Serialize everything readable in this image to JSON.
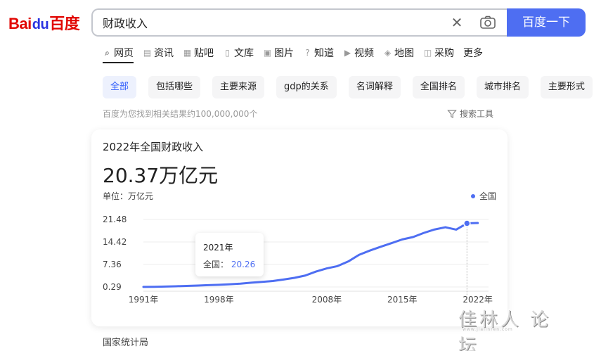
{
  "logo": {
    "part1": "Bai",
    "part2": "du",
    "part3": "百度"
  },
  "search": {
    "query": "财政收入",
    "button_label": "百度一下"
  },
  "tabs": [
    {
      "label": "网页",
      "icon": "search-icon",
      "active": true
    },
    {
      "label": "资讯",
      "icon": "news-icon"
    },
    {
      "label": "贴吧",
      "icon": "tieba-icon"
    },
    {
      "label": "文库",
      "icon": "doc-icon"
    },
    {
      "label": "图片",
      "icon": "image-icon"
    },
    {
      "label": "知道",
      "icon": "question-icon"
    },
    {
      "label": "视频",
      "icon": "video-icon"
    },
    {
      "label": "地图",
      "icon": "map-icon"
    },
    {
      "label": "采购",
      "icon": "cart-icon"
    },
    {
      "label": "更多"
    }
  ],
  "chips": [
    "全部",
    "包括哪些",
    "主要来源",
    "gdp的关系",
    "名词解释",
    "全国排名",
    "城市排名",
    "主要形式"
  ],
  "result_count": "百度为您找到相关结果约100,000,000个",
  "search_tools": "搜索工具",
  "card": {
    "title": "2022年全国财政收入",
    "value": "20.37万亿元",
    "unit": "单位：万亿元",
    "legend": "全国"
  },
  "tooltip": {
    "year": "2021年",
    "series": "全国：",
    "value": "20.26"
  },
  "source": "国家统计局",
  "watermark": {
    "main": "佳林人 论坛",
    "sub": "www.jialinren.com"
  },
  "colors": {
    "brand_blue": "#4e6ef2",
    "baidu_red": "#e10602"
  },
  "chart_data": {
    "type": "line",
    "x_ticks": [
      "1991年",
      "1998年",
      "2008年",
      "2015年",
      "2022年"
    ],
    "y_ticks": [
      "0.29",
      "7.36",
      "14.42",
      "21.48"
    ],
    "ylim": [
      0.29,
      21.48
    ],
    "series": [
      {
        "name": "全国",
        "x": [
          1991,
          1992,
          1993,
          1994,
          1995,
          1996,
          1997,
          1998,
          1999,
          2000,
          2001,
          2002,
          2003,
          2004,
          2005,
          2006,
          2007,
          2008,
          2009,
          2010,
          2011,
          2012,
          2013,
          2014,
          2015,
          2016,
          2017,
          2018,
          2019,
          2020,
          2021,
          2022
        ],
        "values": [
          0.31,
          0.35,
          0.43,
          0.52,
          0.62,
          0.74,
          0.87,
          0.99,
          1.14,
          1.34,
          1.64,
          1.89,
          2.17,
          2.64,
          3.16,
          3.88,
          5.13,
          6.13,
          6.85,
          8.31,
          10.39,
          11.73,
          12.91,
          14.04,
          15.22,
          15.96,
          17.26,
          18.34,
          19.04,
          18.29,
          20.26,
          20.37
        ]
      }
    ],
    "highlight": {
      "x": 2021,
      "value": 20.26
    }
  }
}
